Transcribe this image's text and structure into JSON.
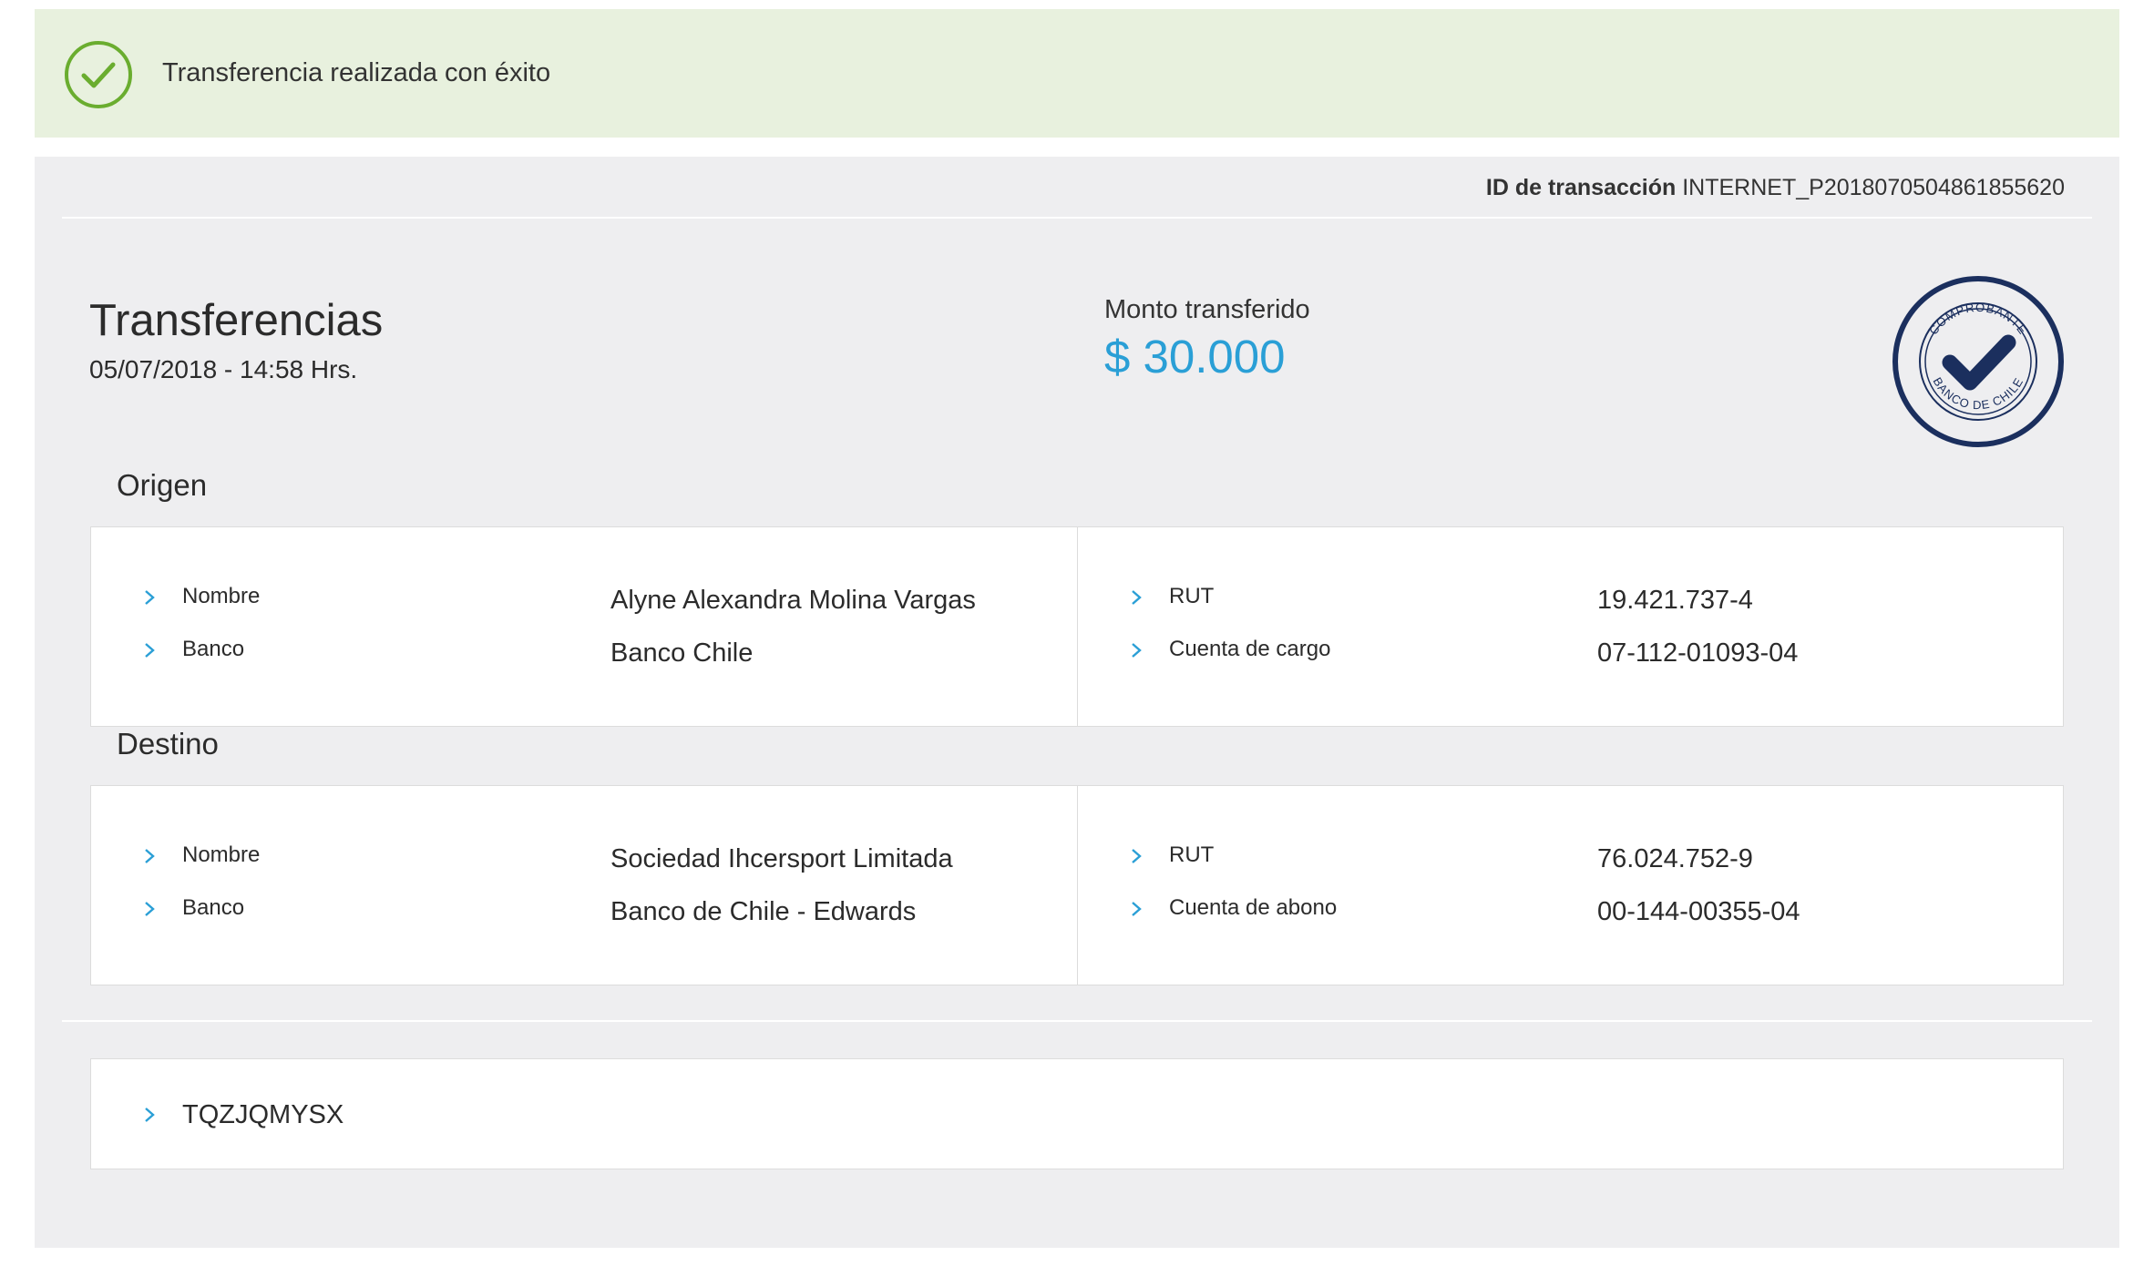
{
  "banner": {
    "message": "Transferencia realizada con éxito",
    "icon": "check-circle-icon",
    "color": "#6aad2f"
  },
  "transaction": {
    "id_label": "ID de transacción",
    "id_value": "INTERNET_P2018070504861855620"
  },
  "header": {
    "title": "Transferencias",
    "date": "05/07/2018 - 14:58 Hrs.",
    "amount_label": "Monto transferido",
    "amount_value": "$ 30.000",
    "amount_color": "#2a9fd6"
  },
  "seal": {
    "top_text": "COMPROBANTE",
    "bottom_text": "BANCO DE CHILE",
    "icon": "check-seal-icon",
    "color": "#1b2f5e"
  },
  "origin": {
    "title": "Origen",
    "left": [
      {
        "label": "Nombre",
        "value": "Alyne Alexandra Molina Vargas"
      },
      {
        "label": "Banco",
        "value": "Banco Chile"
      }
    ],
    "right": [
      {
        "label": "RUT",
        "value": "19.421.737-4"
      },
      {
        "label": "Cuenta de cargo",
        "value": "07-112-01093-04"
      }
    ]
  },
  "destination": {
    "title": "Destino",
    "left": [
      {
        "label": "Nombre",
        "value": "Sociedad Ihcersport Limitada"
      },
      {
        "label": "Banco",
        "value": "Banco de Chile - Edwards"
      }
    ],
    "right": [
      {
        "label": "RUT",
        "value": "76.024.752-9"
      },
      {
        "label": "Cuenta de abono",
        "value": "00-144-00355-04"
      }
    ]
  },
  "code": {
    "value": "TQZJQMYSX"
  }
}
